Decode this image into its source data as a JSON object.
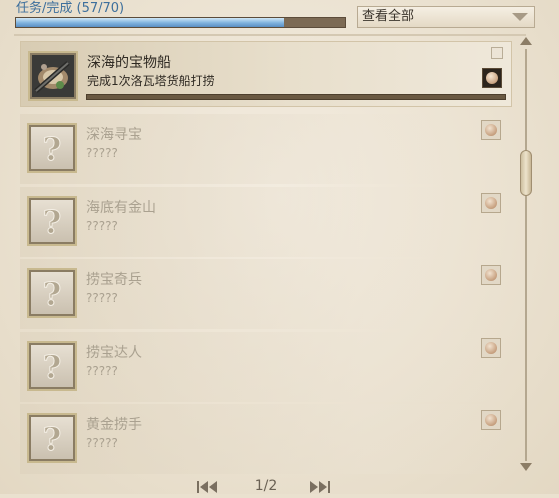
{
  "header": {
    "progress_label": "任务/完成 (57/70)",
    "progress_fraction": 0.814,
    "filter_value": "查看全部",
    "filter_icon": "chevron-down-icon"
  },
  "quests": [
    {
      "title": "深海的宝物船",
      "desc": "完成1次洛瓦塔货船打捞",
      "state": "active",
      "icon": "ship-treasure-icon",
      "reward_icon": "coin-icon"
    },
    {
      "title": "深海寻宝",
      "desc": "?????",
      "state": "locked",
      "icon": "question-mark-icon",
      "reward_icon": "coin-icon"
    },
    {
      "title": "海底有金山",
      "desc": "?????",
      "state": "locked",
      "icon": "question-mark-icon",
      "reward_icon": "coin-icon"
    },
    {
      "title": "捞宝奇兵",
      "desc": "?????",
      "state": "locked",
      "icon": "question-mark-icon",
      "reward_icon": "coin-icon"
    },
    {
      "title": "捞宝达人",
      "desc": "?????",
      "state": "locked",
      "icon": "question-mark-icon",
      "reward_icon": "coin-icon"
    },
    {
      "title": "黄金捞手",
      "desc": "?????",
      "state": "locked",
      "icon": "question-mark-icon",
      "reward_icon": "coin-icon"
    }
  ],
  "pager": {
    "indicator": "1/2",
    "first_icon": "double-chevron-left-icon",
    "last_icon": "double-chevron-right-icon"
  },
  "colors": {
    "progress_fill": "#7fb2de",
    "label_blue": "#3d6f9c",
    "background": "#eae1cf"
  }
}
